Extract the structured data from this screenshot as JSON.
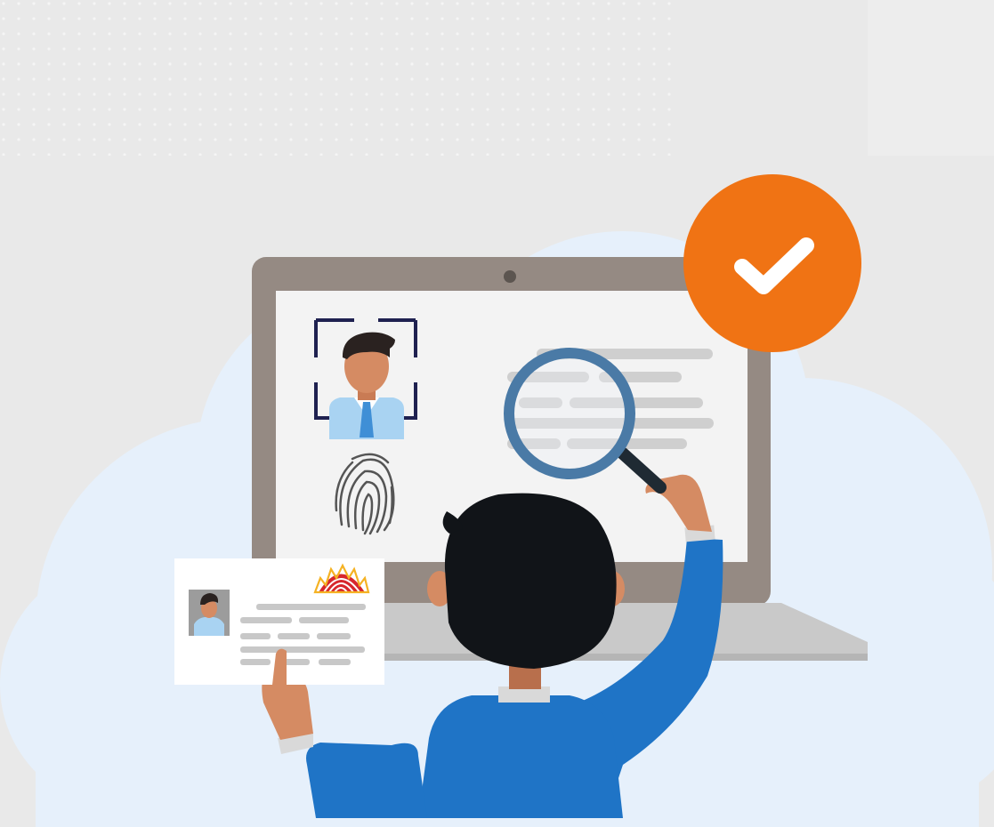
{
  "scene": {
    "colors": {
      "background": "#e9e9e9",
      "dots": "#f6f6f6",
      "cloud": "#e6f0fb",
      "laptop_frame": "#958a83",
      "laptop_base": "#c9c9c9",
      "screen": "#f3f3f3",
      "text_lines": "#cfcfcf",
      "scan_bracket": "#1f2150",
      "skin": "#d58b63",
      "hair": "#111418",
      "shirt_blue": "#1f74c6",
      "shirt_light": "#a9d3f2",
      "magnifier_ring": "#4a7aa6",
      "check_badge": "#f07314",
      "card_bg": "#ffffff",
      "logo_red": "#d7262c",
      "logo_yellow": "#f5b223"
    },
    "icons": [
      "face-scan-icon",
      "fingerprint-icon",
      "magnifier-icon",
      "checkmark-icon",
      "id-card-logo-icon"
    ]
  }
}
